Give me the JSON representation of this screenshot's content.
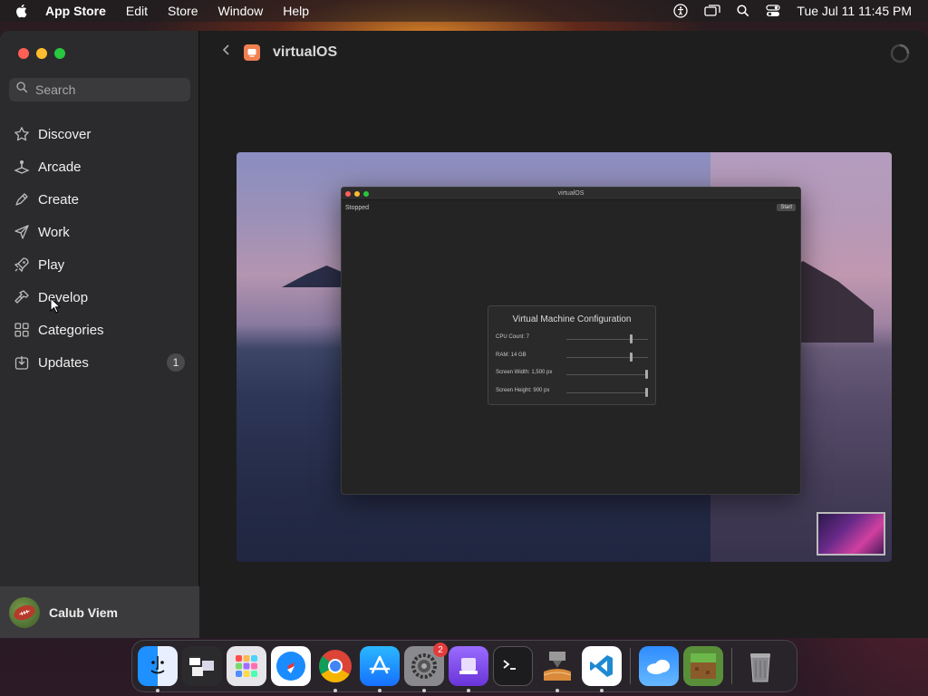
{
  "menubar": {
    "app_name": "App Store",
    "items": [
      "Edit",
      "Store",
      "Window",
      "Help"
    ],
    "datetime": "Tue Jul 11  11:45 PM"
  },
  "sidebar": {
    "search_placeholder": "Search",
    "items": [
      {
        "label": "Discover",
        "icon": "star-icon"
      },
      {
        "label": "Arcade",
        "icon": "joystick-icon"
      },
      {
        "label": "Create",
        "icon": "brush-icon"
      },
      {
        "label": "Work",
        "icon": "paperplane-icon"
      },
      {
        "label": "Play",
        "icon": "rocket-icon"
      },
      {
        "label": "Develop",
        "icon": "hammer-icon"
      },
      {
        "label": "Categories",
        "icon": "grid-icon"
      },
      {
        "label": "Updates",
        "icon": "download-icon",
        "badge": "1"
      }
    ],
    "profile_name": "Calub Viem"
  },
  "content": {
    "page_title": "virtualOS"
  },
  "vm_window": {
    "title": "virtualOS",
    "status": "Stopped",
    "start_label": "Start",
    "config_title": "Virtual Machine Configuration",
    "rows": [
      {
        "label": "CPU Count: 7",
        "value_fraction": 0.8
      },
      {
        "label": "RAM: 14 GB",
        "value_fraction": 0.8
      },
      {
        "label": "Screen Width: 1,500 px",
        "value_fraction": 1.0
      },
      {
        "label": "Screen Height: 900 px",
        "value_fraction": 1.0
      }
    ]
  },
  "dock": {
    "apps": [
      "finder",
      "window-manager",
      "launchpad",
      "safari",
      "chrome",
      "app-store",
      "system-settings",
      "virtualos",
      "terminal",
      "installer",
      "vscode",
      "weather",
      "minecraft",
      "trash"
    ],
    "system_settings_badge": "2"
  },
  "colors": {
    "accent_red": "#fe5f57",
    "accent_yellow": "#febc2e",
    "accent_green": "#28c840"
  }
}
